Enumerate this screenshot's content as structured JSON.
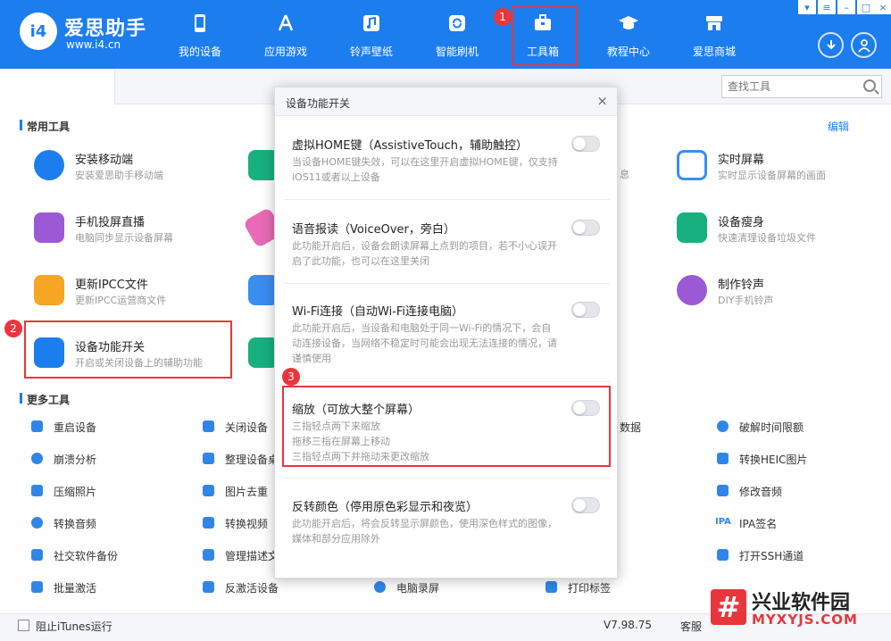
{
  "app": {
    "brand": "爱思助手",
    "url": "www.i4.cn",
    "logo_text": "i4"
  },
  "nav": {
    "items": [
      {
        "label": "我的设备",
        "icon": "phone-icon"
      },
      {
        "label": "应用游戏",
        "icon": "app-store-icon"
      },
      {
        "label": "铃声壁纸",
        "icon": "music-icon"
      },
      {
        "label": "智能刷机",
        "icon": "refresh-icon"
      },
      {
        "label": "工具箱",
        "icon": "toolbox-icon"
      },
      {
        "label": "教程中心",
        "icon": "graduation-cap-icon"
      },
      {
        "label": "爱思商城",
        "icon": "shop-icon"
      }
    ],
    "active": "工具箱"
  },
  "badges": {
    "b1": "1",
    "b2": "2",
    "b3": "3"
  },
  "search": {
    "placeholder": "查找工具"
  },
  "common_tools": {
    "title": "常用工具",
    "edit": "编辑",
    "items": [
      {
        "name": "安装移动端",
        "desc": "安装爱思助手移动端",
        "color": "#1c7dee"
      },
      {
        "name": "实时屏幕",
        "desc": "实时显示设备屏幕的画面",
        "color": "#3a8ef0"
      },
      {
        "name": "手机投屏直播",
        "desc": "电脑同步显示设备屏幕",
        "color": "#9b59d6"
      },
      {
        "name": "设备瘦身",
        "desc": "快速清理设备垃圾文件",
        "color": "#19b07f"
      },
      {
        "name": "更新IPCC文件",
        "desc": "更新IPCC运营商文件",
        "color": "#f5a623"
      },
      {
        "name": "制作铃声",
        "desc": "DIY手机铃声",
        "color": "#9b59d6"
      },
      {
        "name": "设备功能开关",
        "desc": "开启或关闭设备上的辅助功能",
        "color": "#1c7dee"
      }
    ],
    "partial": {
      "desc_a": "息",
      "desc_b": "数据"
    }
  },
  "more_tools": {
    "title": "更多工具",
    "items": [
      "重启设备",
      "关闭设备",
      "破解时间限额",
      "崩溃分析",
      "整理设备桌",
      "转换HEIC图片",
      "压缩照片",
      "图片去重",
      "修改音频",
      "转换音频",
      "转换视频",
      "IPA签名",
      "社交软件备份",
      "管理描述文",
      "打开SSH通道",
      "批量激活",
      "反激活设备",
      "电脑录屏",
      "打印标签"
    ]
  },
  "modal": {
    "title": "设备功能开关",
    "close": "×",
    "options": [
      {
        "title": "虚拟HOME键（AssistiveTouch，辅助触控）",
        "desc": "当设备HOME键失效，可以在这里开启虚拟HOME键，仅支持iOS11或者以上设备",
        "enabled": false
      },
      {
        "title": "语音报读（VoiceOver，旁白）",
        "desc": "此功能开启后，设备会朗读屏幕上点到的项目，若不小心误开启了此功能，也可以在这里关闭",
        "enabled": false
      },
      {
        "title": "Wi-Fi连接（自动Wi-Fi连接电脑）",
        "desc": "此功能开启后，当设备和电脑处于同一Wi-Fi的情况下，会自动连接设备，当网络不稳定时可能会出现无法连接的情况，请谨慎使用",
        "enabled": false
      },
      {
        "title": "缩放（可放大整个屏幕）",
        "desc_lines": [
          "三指轻点两下来缩放",
          "拖移三指在屏幕上移动",
          "三指轻点两下并拖动来更改缩放"
        ],
        "enabled": false
      },
      {
        "title": "反转颜色（停用原色彩显示和夜览）",
        "desc": "此功能开启后，将会反转显示屏颜色，使用深色样式的图像，媒体和部分应用除外",
        "enabled": false
      }
    ]
  },
  "footer": {
    "itunes_label": "阻止iTunes运行",
    "version": "V7.98.75",
    "service": "客服"
  },
  "watermark": {
    "glyph": "#",
    "title": "兴业软件园",
    "url": "MYXYJS.COM"
  },
  "colors": {
    "accent": "#1c7dee",
    "highlight": "#e8363c"
  }
}
